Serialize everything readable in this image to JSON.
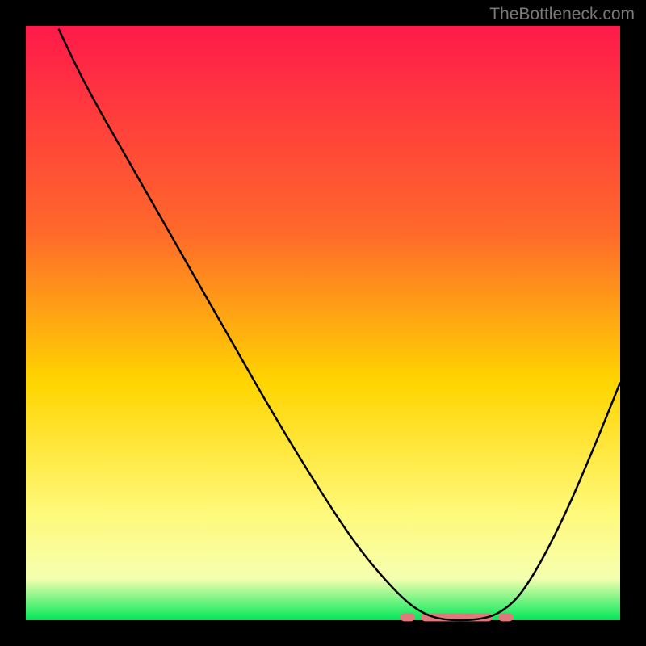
{
  "watermark": "TheBottleneck.com",
  "chart_data": {
    "type": "line",
    "title": "",
    "xlabel": "",
    "ylabel": "",
    "xlim": [
      0,
      100
    ],
    "ylim": [
      0,
      100
    ],
    "background_gradient_stops": [
      {
        "offset": 0,
        "color": "#ff1a4a"
      },
      {
        "offset": 35,
        "color": "#ff6a2a"
      },
      {
        "offset": 60,
        "color": "#ffd500"
      },
      {
        "offset": 82,
        "color": "#fff97a"
      },
      {
        "offset": 93,
        "color": "#f6ffb0"
      },
      {
        "offset": 100,
        "color": "#00e85a"
      }
    ],
    "series": [
      {
        "name": "bottleneck-curve",
        "color": "#000000",
        "points": [
          {
            "x": 5.5,
            "y": 99.5
          },
          {
            "x": 10,
            "y": 90
          },
          {
            "x": 18,
            "y": 76
          },
          {
            "x": 26,
            "y": 62
          },
          {
            "x": 34,
            "y": 48
          },
          {
            "x": 42,
            "y": 34
          },
          {
            "x": 50,
            "y": 21
          },
          {
            "x": 56,
            "y": 12
          },
          {
            "x": 62,
            "y": 5
          },
          {
            "x": 66,
            "y": 1.5
          },
          {
            "x": 70,
            "y": 0
          },
          {
            "x": 76,
            "y": 0
          },
          {
            "x": 80,
            "y": 1.2
          },
          {
            "x": 84,
            "y": 5
          },
          {
            "x": 90,
            "y": 16
          },
          {
            "x": 96,
            "y": 30
          },
          {
            "x": 100,
            "y": 40
          }
        ]
      }
    ],
    "highlight_band": {
      "color": "#e07a7a",
      "y": 0.5,
      "segments": [
        {
          "x0": 63,
          "x1": 65.5
        },
        {
          "x0": 66.5,
          "x1": 78.5
        },
        {
          "x0": 79.5,
          "x1": 82
        }
      ]
    },
    "plot_frame": {
      "border_color": "#000000",
      "border_width_px": 32
    }
  }
}
